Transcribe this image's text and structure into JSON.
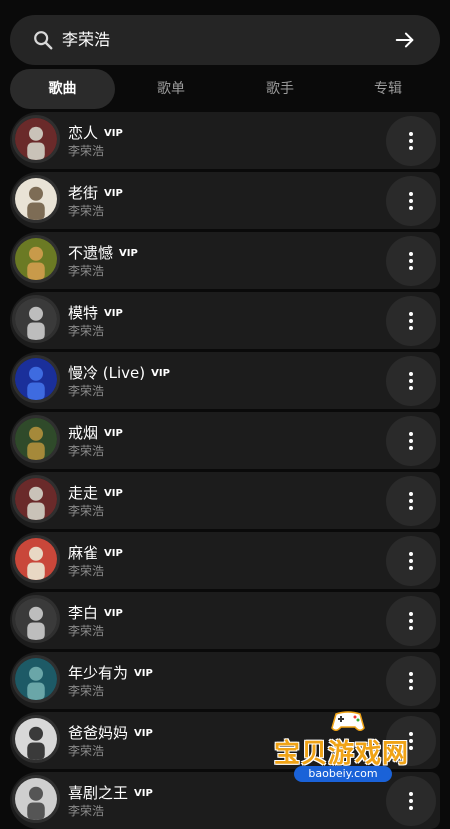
{
  "search": {
    "query": "李荣浩"
  },
  "tabs": [
    {
      "label": "歌曲",
      "active": true
    },
    {
      "label": "歌单",
      "active": false
    },
    {
      "label": "歌手",
      "active": false
    },
    {
      "label": "专辑",
      "active": false
    }
  ],
  "songs": [
    {
      "title": "恋人",
      "badge": "VIP",
      "artist": "李荣浩",
      "cover_colors": [
        "#6a2a2a",
        "#c9c2b8"
      ]
    },
    {
      "title": "老街",
      "badge": "VIP",
      "artist": "李荣浩",
      "cover_colors": [
        "#e9e3d6",
        "#7d6c55"
      ]
    },
    {
      "title": "不遗憾",
      "badge": "VIP",
      "artist": "李荣浩",
      "cover_colors": [
        "#6b7a24",
        "#c89a4a"
      ]
    },
    {
      "title": "模特",
      "badge": "VIP",
      "artist": "李荣浩",
      "cover_colors": [
        "#3a3a3a",
        "#bdbdbd"
      ]
    },
    {
      "title": "慢冷 (Live)",
      "badge": "VIP",
      "artist": "李荣浩",
      "cover_colors": [
        "#1a2f9a",
        "#3e6be0"
      ]
    },
    {
      "title": "戒烟",
      "badge": "VIP",
      "artist": "李荣浩",
      "cover_colors": [
        "#2f4a2a",
        "#a5893a"
      ]
    },
    {
      "title": "走走",
      "badge": "VIP",
      "artist": "李荣浩",
      "cover_colors": [
        "#6a2a2a",
        "#c9c2b8"
      ]
    },
    {
      "title": "麻雀",
      "badge": "VIP",
      "artist": "李荣浩",
      "cover_colors": [
        "#c9473a",
        "#e8d8c4"
      ]
    },
    {
      "title": "李白",
      "badge": "VIP",
      "artist": "李荣浩",
      "cover_colors": [
        "#3a3a3a",
        "#bdbdbd"
      ]
    },
    {
      "title": "年少有为",
      "badge": "VIP",
      "artist": "李荣浩",
      "cover_colors": [
        "#1d5a66",
        "#6aa6a8"
      ]
    },
    {
      "title": "爸爸妈妈",
      "badge": "VIP",
      "artist": "李荣浩",
      "cover_colors": [
        "#d8d8d8",
        "#3a3a3a"
      ]
    },
    {
      "title": "喜剧之王",
      "badge": "VIP",
      "artist": "李荣浩",
      "cover_colors": [
        "#cfcfcf",
        "#555555"
      ]
    }
  ],
  "watermark": {
    "name": "宝贝游戏网",
    "url": "baobeiy.com"
  },
  "colors": {
    "background": "#0a0a0a",
    "row": "#1c1c1c",
    "accent_watermark": "#f0a316"
  }
}
